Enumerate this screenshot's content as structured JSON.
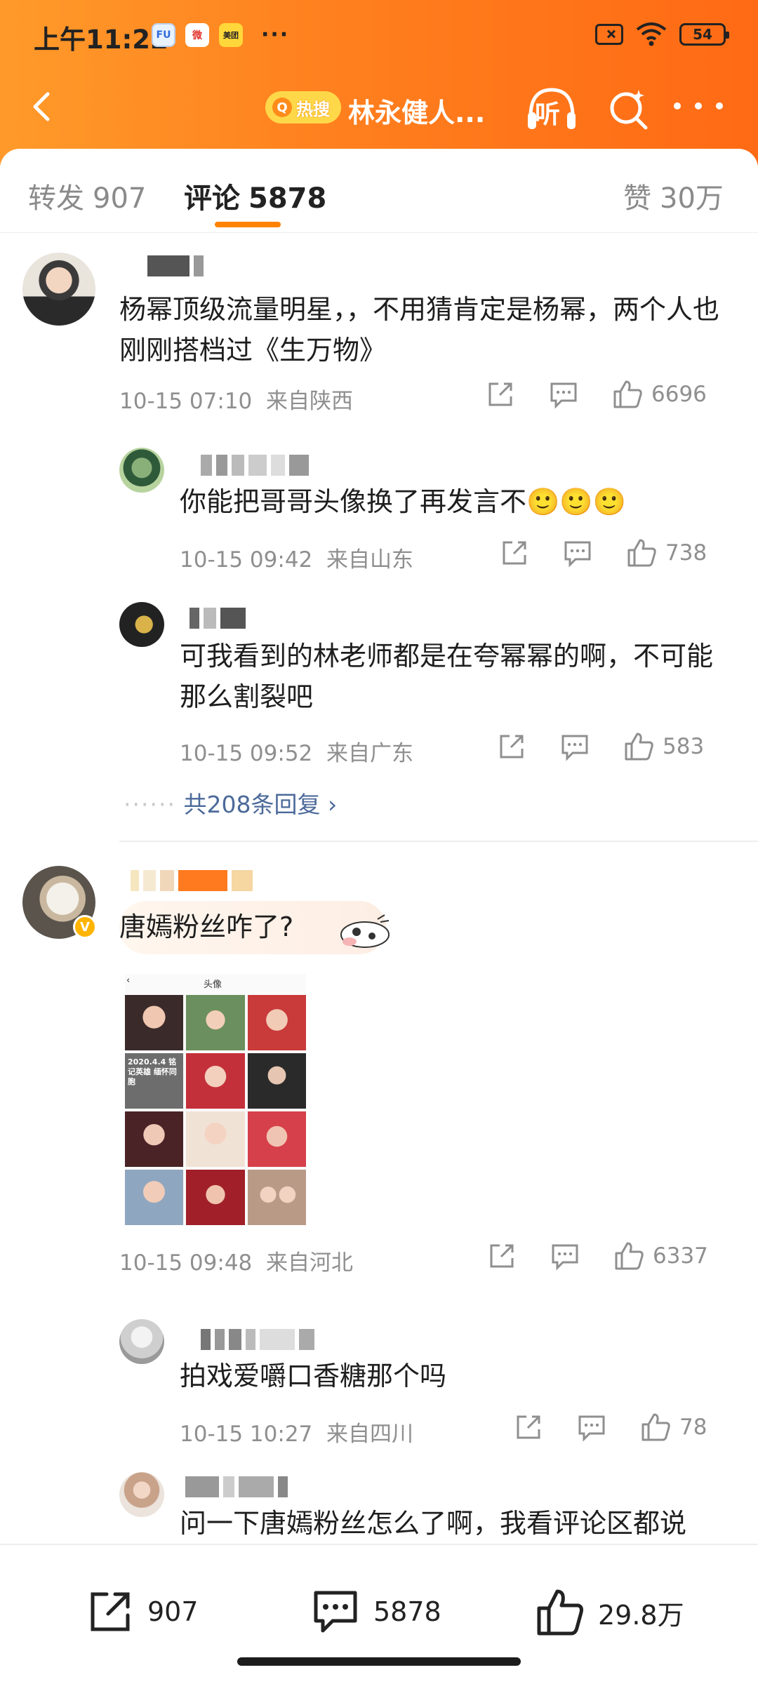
{
  "status_bar": {
    "time": "上午11:22",
    "app1": "FU",
    "app2": "微",
    "app3": "美团",
    "more": "···",
    "battery": "54"
  },
  "nav": {
    "hot_label": "热搜",
    "title": "林永健人...",
    "listen_label": "听"
  },
  "tabs": [
    {
      "label": "转发",
      "count": "907"
    },
    {
      "label": "评论",
      "count": "5878"
    },
    {
      "label": "赞",
      "count": "30万"
    }
  ],
  "comments": [
    {
      "text": "杨幂顶级流量明星，，不用猜肯定是杨幂，两个人也刚刚搭档过《生万物》",
      "time": "10-15 07:10",
      "location": "来自陕西",
      "likes": "6696",
      "replies": [
        {
          "text": "你能把哥哥头像换了再发言不🙂🙂🙂",
          "time": "10-15 09:42",
          "location": "来自山东",
          "likes": "738"
        },
        {
          "text": "可我看到的林老师都是在夸幂幂的啊，不可能那么割裂吧",
          "time": "10-15 09:52",
          "location": "来自广东",
          "likes": "583"
        }
      ],
      "more_replies": "共208条回复"
    },
    {
      "text": "唐嫣粉丝咋了?",
      "image_header": "头像",
      "image_caption": "2020.4.4 铭记英雄 缅怀同胞",
      "time": "10-15 09:48",
      "location": "来自河北",
      "likes": "6337",
      "replies": [
        {
          "text": "拍戏爱嚼口香糖那个吗",
          "time": "10-15 10:27",
          "location": "来自四川",
          "likes": "78"
        },
        {
          "text": "问一下唐嫣粉丝怎么了啊，我看评论区都说"
        }
      ]
    }
  ],
  "bottom_bar": {
    "repost": "907",
    "comment": "5878",
    "like": "29.8万"
  },
  "colors": {
    "accent": "#ff8200",
    "header_start": "#ff9a2a",
    "header_end": "#ff6a14",
    "link": "#4c6a9a"
  }
}
